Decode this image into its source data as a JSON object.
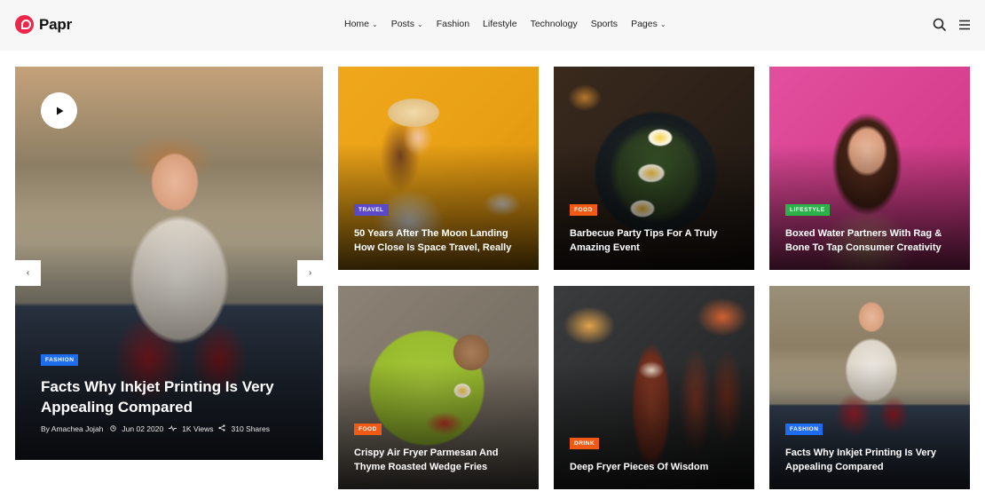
{
  "brand": {
    "name": "Papr",
    "accent": "#f0254a"
  },
  "nav": {
    "items": [
      {
        "label": "Home",
        "has_dropdown": true
      },
      {
        "label": "Posts",
        "has_dropdown": true
      },
      {
        "label": "Fashion",
        "has_dropdown": false
      },
      {
        "label": "Lifestyle",
        "has_dropdown": false
      },
      {
        "label": "Technology",
        "has_dropdown": false
      },
      {
        "label": "Sports",
        "has_dropdown": false
      },
      {
        "label": "Pages",
        "has_dropdown": true
      }
    ],
    "icons": [
      "search-icon",
      "menu-icon"
    ]
  },
  "hero": {
    "category": "FASHION",
    "category_color": "#1e6cf0",
    "title_line1": "Facts Why Inkjet Printing Is Very",
    "title_line2": "Appealing Compared",
    "author": "By Amachea Jojah",
    "date": "Jun 02 2020",
    "views": "1K Views",
    "shares": "310 Shares",
    "prev_icon": "chevron-left-icon",
    "next_icon": "chevron-right-icon",
    "play_icon": "play-icon"
  },
  "cards": [
    {
      "category": "TRAVEL",
      "category_color": "#5a49c9",
      "line1": "50 Years After The Moon Landing",
      "line2": "How Close Is Space Travel, Really"
    },
    {
      "category": "FOOD",
      "category_color": "#f05a14",
      "line1": "Barbecue Party Tips For A Truly",
      "line2": "Amazing Event"
    },
    {
      "category": "LIFESTYLE",
      "category_color": "#2bb34a",
      "line1": "Boxed Water Partners With Rag &",
      "line2": "Bone To Tap Consumer Creativity"
    },
    {
      "category": "FOOD",
      "category_color": "#f05a14",
      "line1": "Crispy Air Fryer Parmesan And",
      "line2": "Thyme Roasted Wedge Fries"
    },
    {
      "category": "DRINK",
      "category_color": "#f05a14",
      "line1": "Deep Fryer Pieces Of Wisdom",
      "line2": ""
    },
    {
      "category": "FASHION",
      "category_color": "#1e6cf0",
      "line1": "Facts Why Inkjet Printing Is Very",
      "line2": "Appealing Compared"
    }
  ]
}
